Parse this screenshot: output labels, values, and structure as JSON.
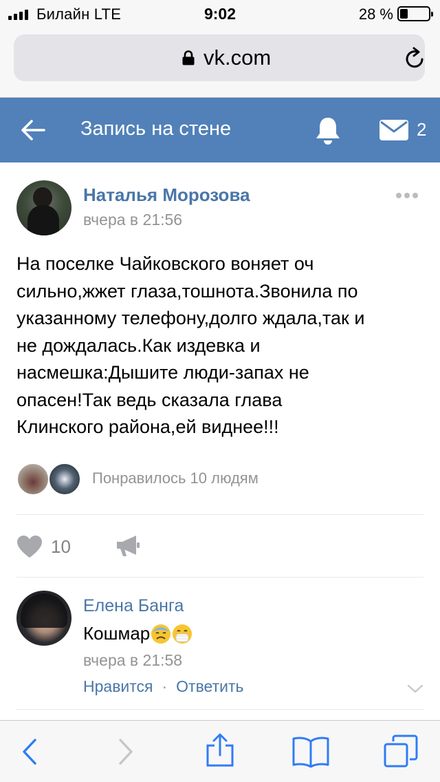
{
  "status_bar": {
    "carrier": "Билайн  LTE",
    "time": "9:02",
    "battery_percent": "28 %",
    "battery_level": 0.28
  },
  "browser": {
    "url": "vk.com"
  },
  "header": {
    "title": "Запись на стене",
    "messages_count": "2",
    "accent_color": "#5181b8"
  },
  "post": {
    "author": "Наталья Морозова",
    "time": "вчера в 21:56",
    "text": "На поселке Чайковского воняет оч\nсильно,жжет глаза,тошнота.Звонила по\nуказанному телефону,долго ждала,так и\nне дождалась.Как издевка и\nнасмешка:Дышите люди-запах не\nопасен!Так ведь сказала глава\nКлинского района,ей виднее!!!",
    "likes_summary": "Понравилось 10 людям",
    "likes_count": "10",
    "link_color": "#4a76a8"
  },
  "comment": {
    "author": "Елена Банга",
    "text": "Кошмар",
    "emojis": [
      "cold-sweat-face",
      "mask-face"
    ],
    "time": "вчера в 21:58",
    "like_label": "Нравится",
    "separator": "·",
    "reply_label": "Ответить"
  },
  "toolbar": {
    "icons": [
      "back-icon",
      "forward-icon",
      "share-icon",
      "bookmarks-icon",
      "tabs-icon"
    ],
    "tint_color": "#2f7cf6"
  }
}
